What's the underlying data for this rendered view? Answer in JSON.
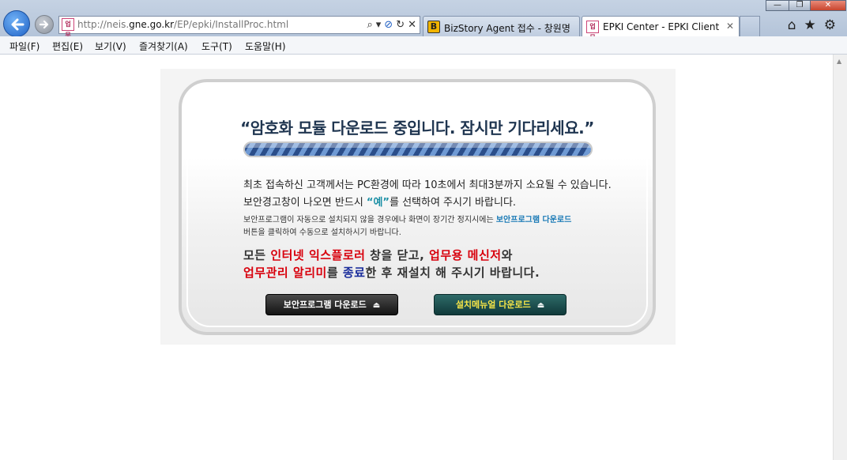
{
  "browser": {
    "url_prefix": "http://neis.",
    "url_domain": "gne.go.kr",
    "url_path": "/EP/epki/InstallProc.html",
    "site_icon_text": "업무",
    "address_tools": [
      "⌕",
      "▾",
      "⊘",
      "↻",
      "✕"
    ],
    "tabs": [
      {
        "title": "BizStory Agent 접수 - 창원명...",
        "icon": "B",
        "active": false
      },
      {
        "title": "EPKI Center - EPKI Client T...",
        "icon": "업무",
        "active": true
      }
    ],
    "tab_close": "✕",
    "window_controls": {
      "minimize": "—",
      "maximize": "❐",
      "close": "✕"
    },
    "tool_icons": {
      "home": "⌂",
      "favorites": "★",
      "settings": "⚙"
    }
  },
  "menubar": {
    "items": [
      "파일(F)",
      "편집(E)",
      "보기(V)",
      "즐겨찾기(A)",
      "도구(T)",
      "도움말(H)"
    ]
  },
  "panel": {
    "headline": "“암호화 모듈 다운로드 중입니다. 잠시만 기다리세요.”",
    "progress": 1.0,
    "line1": "최초 접속하신 고객께서는 PC환경에 따라 10초에서 최대3분까지 소요될 수 있습니다.",
    "line2_a": "보안경고창이 나오면 반드시 ",
    "line2_highlight": "“예”",
    "line2_b": "를 선택하여 주시기 바랍니다.",
    "small1_a": "보안프로그램이 자동으로 설치되지 않을 경우에나 화면이 장기간 정지시에는 ",
    "small1_link": "보안프로그램 다운로드",
    "small2": "버튼을 클릭하여 수동으로 설치하시기 바랍니다.",
    "warn1": [
      {
        "text": "모든 ",
        "style": "normal"
      },
      {
        "text": "인터넷 익스플로러",
        "style": "red"
      },
      {
        "text": " 창을 닫고, ",
        "style": "normal"
      },
      {
        "text": "업무용 메신저",
        "style": "red"
      },
      {
        "text": "와",
        "style": "normal"
      }
    ],
    "warn2": [
      {
        "text": "업무관리 알리미",
        "style": "red"
      },
      {
        "text": "를 ",
        "style": "normal"
      },
      {
        "text": "종료",
        "style": "blue"
      },
      {
        "text": "한 후 재설치 해 주시기 바랍니다.",
        "style": "normal"
      }
    ],
    "btn_security": "보안프로그램 다운로드",
    "btn_manual": "설치메뉴얼 다운로드",
    "btn_icon": "⏏"
  }
}
